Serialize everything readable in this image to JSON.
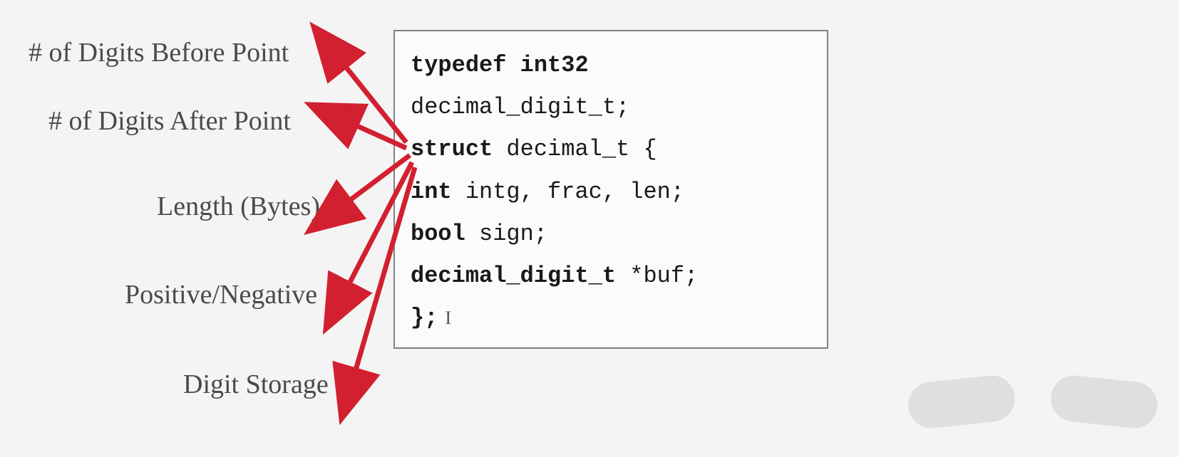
{
  "labels": {
    "before": "# of Digits Before Point",
    "after": "# of Digits After Point",
    "length": "Length (Bytes)",
    "sign": "Positive/Negative",
    "storage": "Digit Storage"
  },
  "code": {
    "l1_kw1": "typedef",
    "l1_kw2": "int32",
    "l1_rest": " decimal_digit_t;",
    "l2_kw": "struct",
    "l2_rest": " decimal_t {",
    "l3_kw": "int",
    "l3_rest": " intg, frac, len;",
    "l4_kw": "bool",
    "l4_rest": " sign;",
    "l5_kw": "decimal_digit_t",
    "l5_rest": " *buf;",
    "l6": "};"
  },
  "arrow_color": "#d22030"
}
